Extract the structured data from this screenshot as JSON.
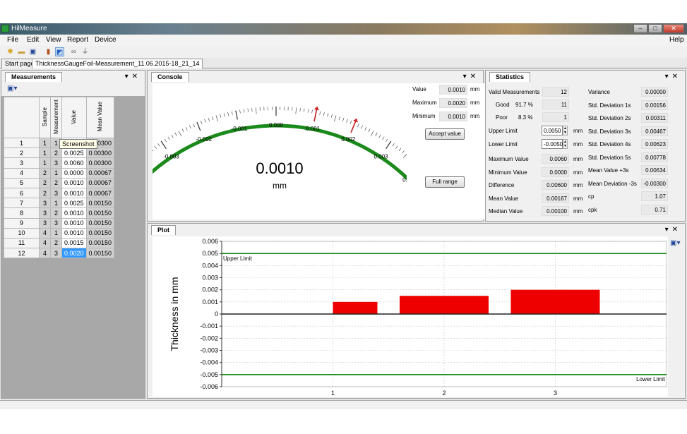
{
  "window": {
    "title": "HilMeasure",
    "buttons": [
      "–",
      "□",
      "✕"
    ]
  },
  "menu": {
    "items": [
      "File",
      "Edit",
      "View",
      "Report",
      "Device"
    ],
    "help": "Help"
  },
  "toolbar": {
    "icons": [
      "new-file-icon",
      "open-folder-icon",
      "save-icon",
      "bar-chart-icon",
      "chart-view-icon",
      "binoculars-icon",
      "plug-icon"
    ]
  },
  "doc_tabs": [
    "Start page",
    "ThicknessGaugeFoil-Measurement_11.06.2015-18_21_14"
  ],
  "measurements": {
    "tab": "Measurements",
    "tooltip": "Screenshot",
    "headers": [
      "Sample",
      "Measurement",
      "Value",
      "Mean Value"
    ],
    "rows": [
      {
        "n": "1",
        "sample": "1",
        "meas": "1",
        "value": "0.0005",
        "mean": "0.00300"
      },
      {
        "n": "2",
        "sample": "1",
        "meas": "2",
        "value": "0.0025",
        "mean": "0.00300"
      },
      {
        "n": "3",
        "sample": "1",
        "meas": "3",
        "value": "0.0060",
        "mean": "0.00300"
      },
      {
        "n": "4",
        "sample": "2",
        "meas": "1",
        "value": "0.0000",
        "mean": "0.00067"
      },
      {
        "n": "5",
        "sample": "2",
        "meas": "2",
        "value": "0.0010",
        "mean": "0.00067"
      },
      {
        "n": "6",
        "sample": "2",
        "meas": "3",
        "value": "0.0010",
        "mean": "0.00067"
      },
      {
        "n": "7",
        "sample": "3",
        "meas": "1",
        "value": "0.0025",
        "mean": "0.00150"
      },
      {
        "n": "8",
        "sample": "3",
        "meas": "2",
        "value": "0.0010",
        "mean": "0.00150"
      },
      {
        "n": "9",
        "sample": "3",
        "meas": "3",
        "value": "0.0010",
        "mean": "0.00150"
      },
      {
        "n": "10",
        "sample": "4",
        "meas": "1",
        "value": "0.0010",
        "mean": "0.00150"
      },
      {
        "n": "11",
        "sample": "4",
        "meas": "2",
        "value": "0.0015",
        "mean": "0.00150"
      },
      {
        "n": "12",
        "sample": "4",
        "meas": "3",
        "value": "0.0020",
        "mean": "0.00150"
      }
    ],
    "current_row_marker": "▸"
  },
  "console": {
    "tab": "Console",
    "display_value": "0.0010",
    "display_unit": "mm",
    "gauge": {
      "labels": [
        "-0.006",
        "-0.005",
        "-0.004",
        "-0.003",
        "-0.002",
        "-0.001",
        "0.000",
        "0.001",
        "0.002",
        "0.003",
        "0.004",
        "0.005",
        "0.006"
      ],
      "min": -0.006,
      "max": 0.006,
      "green_range": [
        -0.005,
        0.005
      ],
      "needle_value": 0.001,
      "maximum_marker": 0.002
    },
    "readouts": [
      {
        "label": "Value",
        "value": "0.0010",
        "unit": "mm"
      },
      {
        "label": "Maximum",
        "value": "0.0020",
        "unit": "mm"
      },
      {
        "label": "Minimum",
        "value": "0.0010",
        "unit": "mm"
      }
    ],
    "accept_button": "Accept value",
    "range_button": "Full range"
  },
  "statistics": {
    "tab": "Statistics",
    "valid_label": "Valid Measurements",
    "valid_value": "12",
    "good_label": "Good",
    "good_pct": "91.7 %",
    "good_value": "11",
    "poor_label": "Poor",
    "poor_pct": "8.3 %",
    "poor_value": "1",
    "upper_limit_label": "Upper Limit",
    "upper_limit": "0.0050",
    "upper_unit": "mm",
    "lower_limit_label": "Lower Limit",
    "lower_limit": "-0.0050",
    "lower_unit": "mm",
    "left_rows": [
      {
        "label": "Maximum Value",
        "value": "0.0060",
        "unit": "mm"
      },
      {
        "label": "Minimum Value",
        "value": "0.0000",
        "unit": "mm"
      },
      {
        "label": "Difference",
        "value": "0.00600",
        "unit": "mm"
      },
      {
        "label": "Mean Value",
        "value": "0.00167",
        "unit": "mm"
      },
      {
        "label": "Median Value",
        "value": "0.00100",
        "unit": "mm"
      }
    ],
    "right_rows": [
      {
        "label": "Variance",
        "value": "0.00000"
      },
      {
        "label": "Std. Deviation 1s",
        "value": "0.00156"
      },
      {
        "label": "Std. Deviation 2s",
        "value": "0.00311"
      },
      {
        "label": "Std. Deviation 3s",
        "value": "0.00467"
      },
      {
        "label": "Std. Deviation 4s",
        "value": "0.00623"
      },
      {
        "label": "Std. Deviation 5s",
        "value": "0.00778"
      },
      {
        "label": "Mean Value +3s",
        "value": "0.00634"
      },
      {
        "label": "Mean Deviation -3s",
        "value": "-0.00300"
      },
      {
        "label": "cp",
        "value": "1.07"
      },
      {
        "label": "cpk",
        "value": "0.71"
      }
    ]
  },
  "plot": {
    "tab": "Plot"
  },
  "chart_data": {
    "type": "bar",
    "ylabel": "Thickness in mm",
    "ylim": [
      -0.006,
      0.006
    ],
    "yticks": [
      "0.006",
      "0.005",
      "0.004",
      "0.003",
      "0.002",
      "0.001",
      "0",
      "-0.001",
      "-0.002",
      "-0.003",
      "-0.004",
      "-0.005",
      "-0.006"
    ],
    "xticks": [
      "1",
      "2",
      "3"
    ],
    "bars": [
      {
        "x_from": 1.0,
        "x_to": 1.4,
        "value": 0.001
      },
      {
        "x_from": 1.6,
        "x_to": 2.4,
        "value": 0.0015
      },
      {
        "x_from": 2.6,
        "x_to": 3.4,
        "value": 0.002
      }
    ],
    "xlim": [
      0,
      4
    ],
    "upper_limit": {
      "value": 0.005,
      "label": "Upper Limit"
    },
    "lower_limit": {
      "value": -0.005,
      "label": "Lower Limit"
    },
    "bar_color": "#ee0000",
    "limit_color": "#1a8a1a",
    "grid": true
  },
  "colors": {
    "gauge_green": "#1a8a1a",
    "gauge_needle": "#cc2222",
    "selection": "#3399ff"
  }
}
